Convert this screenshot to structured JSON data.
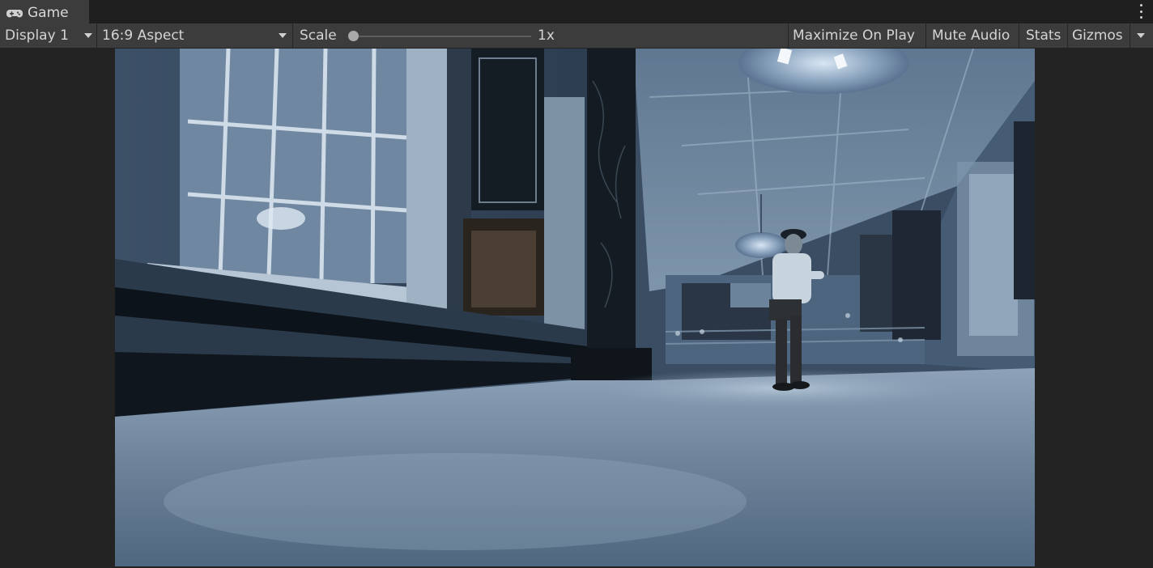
{
  "tab": {
    "title": "Game",
    "icon": "gamepad-icon"
  },
  "toolbar": {
    "display": "Display 1",
    "aspect": "16:9 Aspect",
    "scale_label": "Scale",
    "scale_value": "1x",
    "maximize_on_play": "Maximize On Play",
    "mute_audio": "Mute Audio",
    "stats": "Stats",
    "gizmos": "Gizmos"
  },
  "colors": {
    "tab_bar": "#1f1f1f",
    "toolbar": "#3c3c3c",
    "panel": "#282828",
    "scene_tint": "#3a4d63"
  },
  "scene": {
    "description_icon": "game-viewport"
  }
}
